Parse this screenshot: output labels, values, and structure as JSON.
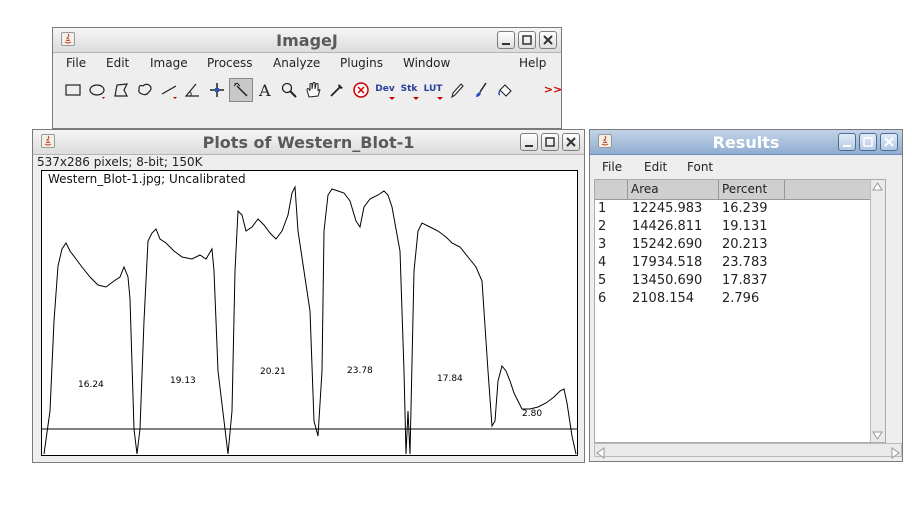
{
  "imagej": {
    "title": "ImageJ",
    "menu": [
      "File",
      "Edit",
      "Image",
      "Process",
      "Analyze",
      "Plugins",
      "Window",
      "Help"
    ],
    "tools": [
      {
        "name": "rectangle-tool-icon"
      },
      {
        "name": "oval-tool-icon"
      },
      {
        "name": "polygon-tool-icon"
      },
      {
        "name": "freehand-tool-icon"
      },
      {
        "name": "straight-line-tool-icon"
      },
      {
        "name": "angle-tool-icon"
      },
      {
        "name": "point-tool-icon"
      },
      {
        "name": "wand-tool-icon"
      },
      {
        "name": "text-tool-icon",
        "text": "A"
      },
      {
        "name": "magnifier-tool-icon"
      },
      {
        "name": "hand-tool-icon"
      },
      {
        "name": "color-picker-tool-icon"
      },
      {
        "name": "close-stop-tool-icon"
      },
      {
        "name": "developer-menu-tool",
        "text": "Dev"
      },
      {
        "name": "stack-menu-tool",
        "text": "Stk"
      },
      {
        "name": "lut-menu-tool",
        "text": "LUT"
      },
      {
        "name": "pencil-tool-icon"
      },
      {
        "name": "brush-tool-icon"
      },
      {
        "name": "flood-fill-tool-icon"
      },
      {
        "name": "more-tools-icon",
        "text": ">>"
      }
    ]
  },
  "plots": {
    "title": "Plots of Western_Blot-1",
    "info": "537x286 pixels; 8-bit; 150K",
    "caption": "Western_Blot-1.jpg; Uncalibrated",
    "band_labels": [
      "16.24",
      "19.13",
      "20.21",
      "23.78",
      "17.84",
      "2.80"
    ]
  },
  "results": {
    "title": "Results",
    "menu": [
      "File",
      "Edit",
      "Font"
    ],
    "columns": [
      "",
      "Area",
      "Percent"
    ],
    "rows": [
      [
        "1",
        "12245.983",
        "16.239"
      ],
      [
        "2",
        "14426.811",
        "19.131"
      ],
      [
        "3",
        "15242.690",
        "20.213"
      ],
      [
        "4",
        "17934.518",
        "23.783"
      ],
      [
        "5",
        "13450.690",
        "17.837"
      ],
      [
        "6",
        "2108.154",
        "2.796"
      ]
    ]
  },
  "colors": {
    "title_text_gray": "#5a5a5a",
    "results_title_blue": "#8fadd0",
    "more_tools_red": "#cc0000"
  }
}
